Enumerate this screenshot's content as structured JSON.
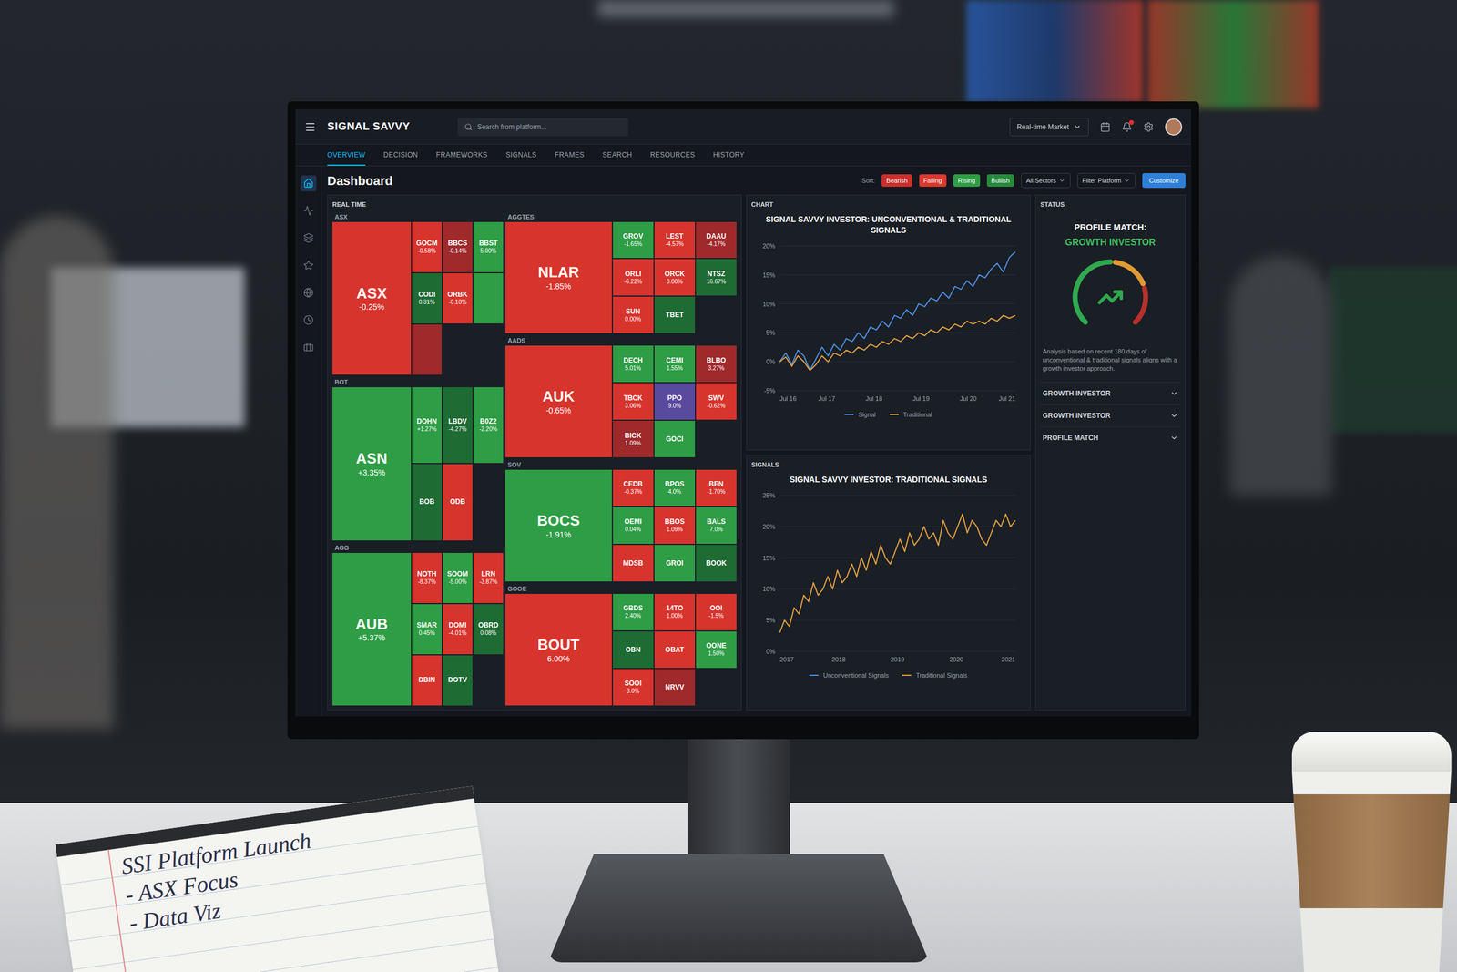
{
  "app": {
    "brand": "SIGNAL SAVVY"
  },
  "search": {
    "placeholder": "Search from platform..."
  },
  "market_select": {
    "value": "Real-time Market"
  },
  "notifications": {
    "unread": true
  },
  "tabs": [
    {
      "label": "OVERVIEW",
      "selected": true
    },
    {
      "label": "DECISION",
      "selected": false
    },
    {
      "label": "FRAMEWORKS",
      "selected": false
    },
    {
      "label": "SIGNALS",
      "selected": false
    },
    {
      "label": "FRAMES",
      "selected": false
    },
    {
      "label": "SEARCH",
      "selected": false
    },
    {
      "label": "RESOURCES",
      "selected": false
    },
    {
      "label": "HISTORY",
      "selected": false
    }
  ],
  "sidebar": {
    "items": [
      {
        "selected": true
      },
      {
        "selected": false
      },
      {
        "selected": false
      },
      {
        "selected": false
      },
      {
        "selected": false
      },
      {
        "selected": false
      },
      {
        "selected": false
      }
    ]
  },
  "page_title": "Dashboard",
  "sort": {
    "label": "Sort:",
    "chips": [
      {
        "label": "Bearish",
        "color": "#c9302c"
      },
      {
        "label": "Falling",
        "color": "#d9382f"
      },
      {
        "label": "Rising",
        "color": "#2e9d45"
      },
      {
        "label": "Bullish",
        "color": "#268a3d"
      }
    ]
  },
  "filters": [
    {
      "label": "All Sectors"
    },
    {
      "label": "Filter Platform"
    }
  ],
  "primary_button": "Customize",
  "heatmap": {
    "title": "REAL TIME",
    "columns": [
      [
        {
          "label": "ASX",
          "tiles": [
            {
              "label": "ASX",
              "change": "-0.25%",
              "color": "#d7342d"
            },
            {
              "label": "GOCM",
              "change": "-0.58%",
              "color": "#d7342d"
            },
            {
              "label": "BBCS",
              "change": "-0.14%",
              "color": "#9e2a2b"
            },
            {
              "label": "BBST",
              "change": "5.00%",
              "color": "#2e9d45"
            },
            {
              "label": "CODI",
              "change": "0.31%",
              "color": "#1e6b34"
            },
            {
              "label": "ORBK",
              "change": "-0.10%",
              "color": "#d7342d"
            },
            {
              "label": "",
              "change": "",
              "color": "#2e9d45"
            },
            {
              "label": "",
              "change": "",
              "color": "#9e2a2b"
            }
          ]
        },
        {
          "label": "BOT",
          "tiles": [
            {
              "label": "ASN",
              "change": "+3.35%",
              "color": "#2e9d45"
            },
            {
              "label": "DOHN",
              "change": "+1.27%",
              "color": "#2e9d45"
            },
            {
              "label": "LBDV",
              "change": "-4.27%",
              "color": "#1e6b34"
            },
            {
              "label": "B0Z2",
              "change": "-2.20%",
              "color": "#2e9d45"
            },
            {
              "label": "BOB",
              "change": "",
              "color": "#1e6b34"
            },
            {
              "label": "ODB",
              "change": "",
              "color": "#d7342d"
            }
          ]
        },
        {
          "label": "AGG",
          "tiles": [
            {
              "label": "AUB",
              "change": "+5.37%",
              "color": "#2e9d45"
            },
            {
              "label": "NOTH",
              "change": "-8.37%",
              "color": "#d7342d"
            },
            {
              "label": "SOOM",
              "change": "-5.00%",
              "color": "#2e9d45"
            },
            {
              "label": "LRN",
              "change": "-3.87%",
              "color": "#d7342d"
            },
            {
              "label": "SMAR",
              "change": "0.45%",
              "color": "#2e9d45"
            },
            {
              "label": "DOMI",
              "change": "-4.01%",
              "color": "#d7342d"
            },
            {
              "label": "OBRD",
              "change": "0.08%",
              "color": "#1e6b34"
            },
            {
              "label": "DBIN",
              "change": "",
              "color": "#d7342d"
            },
            {
              "label": "DOTV",
              "change": "",
              "color": "#1e6b34"
            }
          ]
        }
      ],
      [
        {
          "label": "AGGTES",
          "tiles": [
            {
              "label": "NLAR",
              "change": "-1.85%",
              "color": "#d7342d"
            },
            {
              "label": "GROV",
              "change": "-1.65%",
              "color": "#2e9d45"
            },
            {
              "label": "LEST",
              "change": "-4.57%",
              "color": "#d7342d"
            },
            {
              "label": "DAAU",
              "change": "-4.17%",
              "color": "#9e2a2b"
            },
            {
              "label": "ORLI",
              "change": "-6.22%",
              "color": "#d7342d"
            },
            {
              "label": "ORCK",
              "change": "0.00%",
              "color": "#d7342d"
            },
            {
              "label": "NTSZ",
              "change": "16.67%",
              "color": "#1e6b34"
            },
            {
              "label": "SUN",
              "change": "0.00%",
              "color": "#d7342d"
            },
            {
              "label": "TBET",
              "change": "",
              "color": "#1e6b34"
            }
          ]
        },
        {
          "label": "AADS",
          "tiles": [
            {
              "label": "AUK",
              "change": "-0.65%",
              "color": "#d7342d"
            },
            {
              "label": "DECH",
              "change": "5.01%",
              "color": "#2e9d45"
            },
            {
              "label": "CEMI",
              "change": "1.55%",
              "color": "#2e9d45"
            },
            {
              "label": "BLBO",
              "change": "3.27%",
              "color": "#9e2a2b"
            },
            {
              "label": "TBCK",
              "change": "3.06%",
              "color": "#d7342d"
            },
            {
              "label": "PPO",
              "change": "9.0%",
              "color": "#5a4a9e"
            },
            {
              "label": "SWV",
              "change": "-0.62%",
              "color": "#d7342d"
            },
            {
              "label": "BICK",
              "change": "1.09%",
              "color": "#9e2a2b"
            },
            {
              "label": "GOCI",
              "change": "",
              "color": "#2e9d45"
            }
          ]
        },
        {
          "label": "SOV",
          "tiles": [
            {
              "label": "BOCS",
              "change": "-1.91%",
              "color": "#2e9d45"
            },
            {
              "label": "CEDB",
              "change": "-0.37%",
              "color": "#d7342d"
            },
            {
              "label": "BPOS",
              "change": "4.0%",
              "color": "#2e9d45"
            },
            {
              "label": "BEN",
              "change": "-1.70%",
              "color": "#d7342d"
            },
            {
              "label": "OEMI",
              "change": "0.04%",
              "color": "#2e9d45"
            },
            {
              "label": "BBOS",
              "change": "1.09%",
              "color": "#d7342d"
            },
            {
              "label": "BALS",
              "change": "7.0%",
              "color": "#2e9d45"
            },
            {
              "label": "MDSB",
              "change": "",
              "color": "#d7342d"
            },
            {
              "label": "GROI",
              "change": "",
              "color": "#2e9d45"
            },
            {
              "label": "BOOK",
              "change": "",
              "color": "#1e6b34"
            }
          ]
        },
        {
          "label": "GOOE",
          "tiles": [
            {
              "label": "BOUT",
              "change": "6.00%",
              "color": "#d7342d"
            },
            {
              "label": "GBDS",
              "change": "2.40%",
              "color": "#2e9d45"
            },
            {
              "label": "14TO",
              "change": "1.00%",
              "color": "#d7342d"
            },
            {
              "label": "OOI",
              "change": "-1.5%",
              "color": "#d7342d"
            },
            {
              "label": "OBN",
              "change": "",
              "color": "#1e6b34"
            },
            {
              "label": "OBAT",
              "change": "",
              "color": "#d7342d"
            },
            {
              "label": "OONE",
              "change": "1.50%",
              "color": "#2e9d45"
            },
            {
              "label": "SOOI",
              "change": "3.0%",
              "color": "#d7342d"
            },
            {
              "label": "NRVV",
              "change": "",
              "color": "#9e2a2b"
            }
          ]
        }
      ]
    ]
  },
  "chart": {
    "header": "CHART",
    "title": "SIGNAL SAVVY INVESTOR: UNCONVENTIONAL & TRADITIONAL SIGNALS",
    "y_range": [
      -5,
      20
    ],
    "y_ticks": [
      "20%",
      "15%",
      "10%",
      "5%",
      "0%",
      "-5%"
    ],
    "x_ticks": [
      "Jul 16",
      "Jul 17",
      "Jul 18",
      "Jul 19",
      "Jul 20",
      "Jul 21"
    ],
    "series": [
      {
        "name": "Signal",
        "color": "#4a8fe0",
        "values": [
          0,
          1.5,
          -0.5,
          2,
          1,
          -1.5,
          0.5,
          2.5,
          1,
          3,
          2,
          4,
          3.5,
          5,
          4,
          6,
          5.5,
          7,
          6,
          8,
          7.5,
          9,
          8,
          10,
          9.5,
          11,
          10.5,
          12,
          11,
          13,
          12.5,
          14,
          13,
          15,
          14.5,
          16,
          17,
          15.5,
          18,
          19
        ]
      },
      {
        "name": "Traditional",
        "color": "#e0a040",
        "values": [
          0,
          0.8,
          -0.8,
          1,
          0,
          -1.5,
          -0.5,
          1,
          0,
          1.5,
          1,
          2,
          1.5,
          2.5,
          2,
          3,
          2.5,
          3.5,
          3,
          4,
          3.5,
          4.5,
          4,
          5,
          4.5,
          5.5,
          5,
          6,
          5.5,
          6.5,
          6,
          7,
          6.5,
          7,
          6.5,
          7.5,
          7,
          8,
          7.5,
          8
        ]
      }
    ]
  },
  "signals": {
    "header": "SIGNALS",
    "title": "SIGNAL SAVVY INVESTOR: TRADITIONAL SIGNALS",
    "y_range": [
      0,
      25
    ],
    "y_ticks": [
      "25%",
      "20%",
      "15%",
      "10%",
      "5%",
      "0%"
    ],
    "x_ticks": [
      "2017",
      "2018",
      "2019",
      "2020",
      "2021"
    ],
    "series": [
      {
        "name": "Unconventional Signals",
        "color": "#4a8fe0",
        "values": []
      },
      {
        "name": "Traditional Signals",
        "color": "#e0a040",
        "values": [
          3,
          5,
          4,
          7,
          6,
          9,
          8,
          11,
          9,
          10,
          12,
          10,
          13,
          11,
          12,
          14,
          12,
          15,
          13,
          16,
          14,
          17,
          15,
          14,
          16,
          18,
          16,
          19,
          17,
          18,
          20,
          18,
          19,
          17,
          21,
          19,
          18,
          20,
          22,
          19,
          21,
          20,
          18,
          17,
          19,
          21,
          20,
          22,
          20,
          21
        ]
      }
    ]
  },
  "status": {
    "header": "STATUS",
    "match_label": "PROFILE MATCH:",
    "match_value": "GROWTH INVESTOR",
    "description": "Analysis based on recent 180 days of unconventional & traditional signals aligns with a growth investor approach.",
    "sections": [
      {
        "label": "GROWTH INVESTOR",
        "expanded": false
      },
      {
        "label": "GROWTH INVESTOR",
        "expanded": false
      },
      {
        "label": "PROFILE MATCH",
        "expanded": false
      }
    ]
  },
  "notepad": {
    "lines": [
      "SSI Platform Launch",
      "- ASX Focus",
      "- Data Viz"
    ]
  }
}
